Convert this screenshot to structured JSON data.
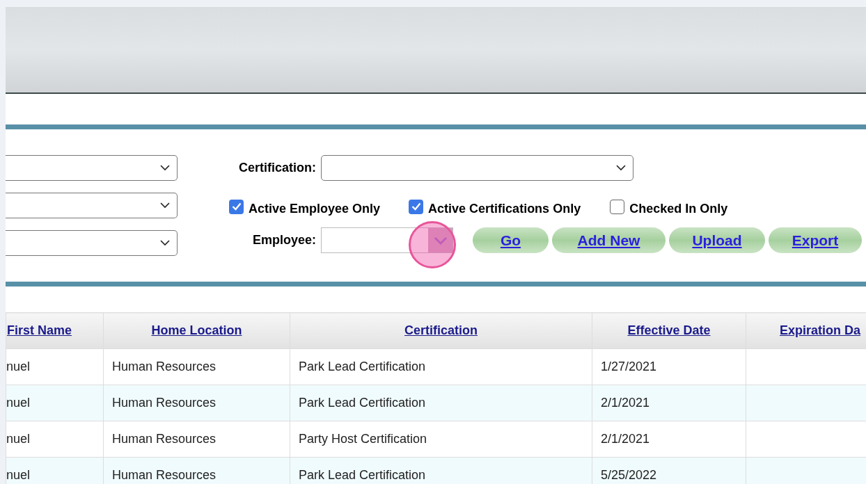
{
  "filters": {
    "certification": {
      "label": "Certification:"
    },
    "checkboxes": [
      {
        "label": "Active Employee Only",
        "checked": true
      },
      {
        "label": "Active Certifications Only",
        "checked": true
      },
      {
        "label": "Checked In Only",
        "checked": false
      }
    ],
    "employee": {
      "label": "Employee:"
    },
    "buttons": [
      "Go",
      "Add New",
      "Upload",
      "Export"
    ]
  },
  "table": {
    "columns": [
      "First Name",
      "Home Location",
      "Certification",
      "Effective Date",
      "Expiration Da"
    ],
    "rows": [
      [
        "nuel",
        "Human Resources",
        "Park Lead Certification",
        "1/27/2021",
        ""
      ],
      [
        "nuel",
        "Human Resources",
        "Park Lead Certification",
        "2/1/2021",
        ""
      ],
      [
        "nuel",
        "Human Resources",
        "Party Host Certification",
        "2/1/2021",
        ""
      ],
      [
        "nuel",
        "Human Resources",
        "Park Lead Certification",
        "5/25/2022",
        ""
      ]
    ]
  }
}
